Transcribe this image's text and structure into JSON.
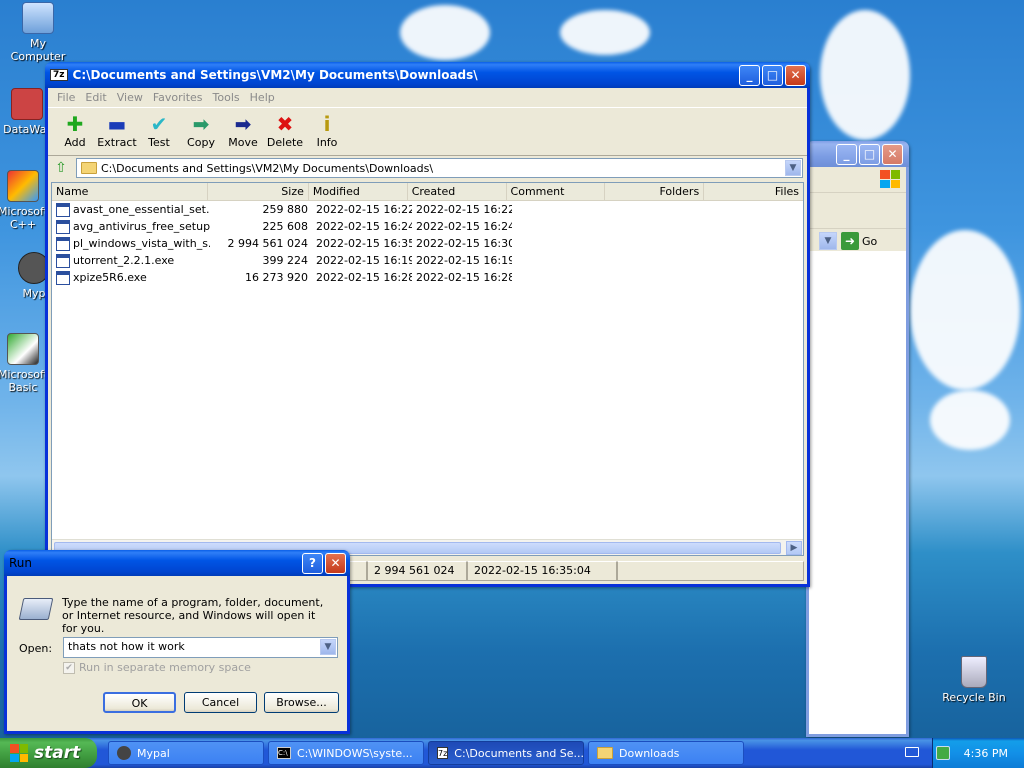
{
  "desktop": {
    "icons": [
      {
        "label": "My Computer"
      },
      {
        "label": "DataWar"
      },
      {
        "label": "Microsoft C++"
      },
      {
        "label": "Myp"
      },
      {
        "label": "Microsoft Basic"
      },
      {
        "label": "Recycle Bin"
      }
    ]
  },
  "sevenzip": {
    "title": "C:\\Documents and Settings\\VM2\\My Documents\\Downloads\\",
    "app_icon": "7z",
    "menu": [
      "File",
      "Edit",
      "View",
      "Favorites",
      "Tools",
      "Help"
    ],
    "toolbar": [
      {
        "label": "Add",
        "icon": "plus-icon"
      },
      {
        "label": "Extract",
        "icon": "minus-icon"
      },
      {
        "label": "Test",
        "icon": "check-icon"
      },
      {
        "label": "Copy",
        "icon": "arrow-right-icon"
      },
      {
        "label": "Move",
        "icon": "arrow-right-icon"
      },
      {
        "label": "Delete",
        "icon": "x-icon"
      },
      {
        "label": "Info",
        "icon": "info-icon"
      }
    ],
    "address": "C:\\Documents and Settings\\VM2\\My Documents\\Downloads\\",
    "columns": [
      "Name",
      "Size",
      "Modified",
      "Created",
      "Comment",
      "Folders",
      "Files"
    ],
    "rows": [
      {
        "name": "avast_one_essential_set...",
        "size": "259 880",
        "modified": "2022-02-15 16:22",
        "created": "2022-02-15 16:22"
      },
      {
        "name": "avg_antivirus_free_setup...",
        "size": "225 608",
        "modified": "2022-02-15 16:24",
        "created": "2022-02-15 16:24"
      },
      {
        "name": "pl_windows_vista_with_s...",
        "size": "2 994 561 024",
        "modified": "2022-02-15 16:35",
        "created": "2022-02-15 16:30"
      },
      {
        "name": "utorrent_2.2.1.exe",
        "size": "399 224",
        "modified": "2022-02-15 16:19",
        "created": "2022-02-15 16:19"
      },
      {
        "name": "xpize5R6.exe",
        "size": "16 273 920",
        "modified": "2022-02-15 16:28",
        "created": "2022-02-15 16:28"
      }
    ],
    "status": {
      "size": "2 994 561 024",
      "modified": "2022-02-15 16:35:04"
    }
  },
  "back_window": {
    "go_label": "Go"
  },
  "run": {
    "title": "Run",
    "description": "Type the name of a program, folder, document, or Internet resource, and Windows will open it for you.",
    "open_label": "Open:",
    "open_value": "thats not how it work",
    "checkbox_label": "Run in separate memory space",
    "ok": "OK",
    "cancel": "Cancel",
    "browse": "Browse...",
    "help": "?",
    "close": "✕"
  },
  "taskbar": {
    "start": "start",
    "tasks": [
      {
        "label": "Mypal"
      },
      {
        "label": "C:\\WINDOWS\\syste..."
      },
      {
        "label": "C:\\Documents and Se..."
      },
      {
        "label": "Downloads"
      }
    ],
    "clock": "4:36 PM"
  }
}
